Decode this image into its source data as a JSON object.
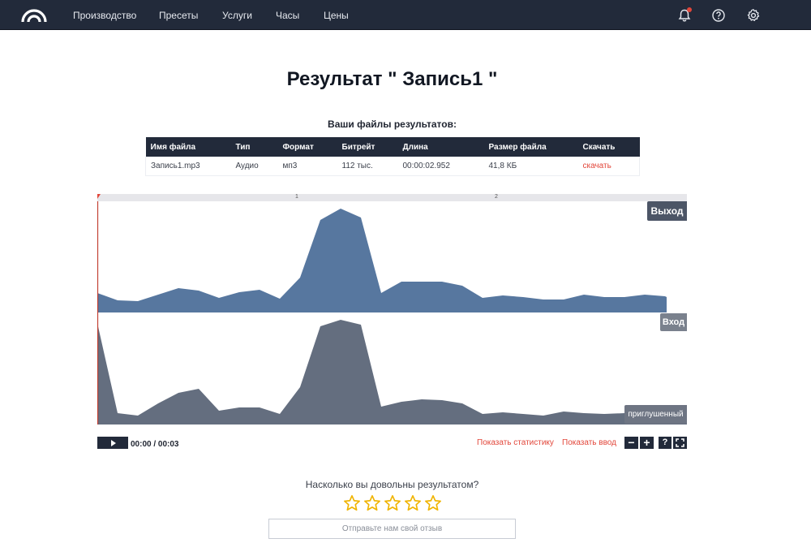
{
  "nav": {
    "items": [
      "Производство",
      "Пресеты",
      "Услуги",
      "Часы",
      "Цены"
    ],
    "icons": [
      "bell-icon",
      "help-icon",
      "gear-icon"
    ]
  },
  "page": {
    "title": "Результат \" Запись1 \"",
    "files_heading": "Ваши файлы результатов:"
  },
  "table": {
    "columns": [
      "Имя файла",
      "Тип",
      "Формат",
      "Битрейт",
      "Длина",
      "Размер файла",
      "Скачать"
    ],
    "rows": [
      [
        "Запись1.mp3",
        "Аудио",
        "мп3",
        "112 тыс.",
        "00:00:02.952",
        "41,8 КБ",
        "скачать"
      ]
    ]
  },
  "player": {
    "ruler_marks": [
      "1",
      "2"
    ],
    "output_label": "Выход",
    "input_label": "Вход",
    "muted_label": "приглушенный",
    "time": "00:00 / 00:03",
    "show_stats": "Показать статистику",
    "show_input": "Показать ввод",
    "zoom_out": "−",
    "zoom_in": "+",
    "help": "?",
    "colors": {
      "output_wave": "#57779f",
      "input_wave": "#646e7f",
      "controls_bg": "#222a3a",
      "link": "#e2463a"
    }
  },
  "rating": {
    "question": "Насколько вы довольны результатом?",
    "stars": 5,
    "feedback_placeholder": "Отправьте нам свой отзыв",
    "star_color": "#f0b400"
  }
}
